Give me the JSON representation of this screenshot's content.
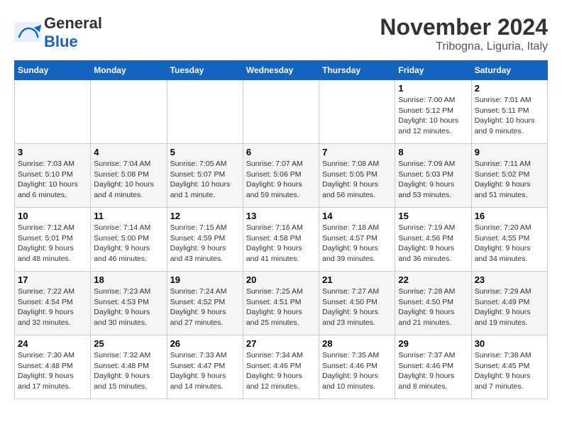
{
  "header": {
    "logo_text_general": "General",
    "logo_text_blue": "Blue",
    "month_title": "November 2024",
    "location": "Tribogna, Liguria, Italy"
  },
  "days_of_week": [
    "Sunday",
    "Monday",
    "Tuesday",
    "Wednesday",
    "Thursday",
    "Friday",
    "Saturday"
  ],
  "weeks": [
    [
      {
        "day": "",
        "info": ""
      },
      {
        "day": "",
        "info": ""
      },
      {
        "day": "",
        "info": ""
      },
      {
        "day": "",
        "info": ""
      },
      {
        "day": "",
        "info": ""
      },
      {
        "day": "1",
        "info": "Sunrise: 7:00 AM\nSunset: 5:12 PM\nDaylight: 10 hours and 12 minutes."
      },
      {
        "day": "2",
        "info": "Sunrise: 7:01 AM\nSunset: 5:11 PM\nDaylight: 10 hours and 9 minutes."
      }
    ],
    [
      {
        "day": "3",
        "info": "Sunrise: 7:03 AM\nSunset: 5:10 PM\nDaylight: 10 hours and 6 minutes."
      },
      {
        "day": "4",
        "info": "Sunrise: 7:04 AM\nSunset: 5:08 PM\nDaylight: 10 hours and 4 minutes."
      },
      {
        "day": "5",
        "info": "Sunrise: 7:05 AM\nSunset: 5:07 PM\nDaylight: 10 hours and 1 minute."
      },
      {
        "day": "6",
        "info": "Sunrise: 7:07 AM\nSunset: 5:06 PM\nDaylight: 9 hours and 59 minutes."
      },
      {
        "day": "7",
        "info": "Sunrise: 7:08 AM\nSunset: 5:05 PM\nDaylight: 9 hours and 56 minutes."
      },
      {
        "day": "8",
        "info": "Sunrise: 7:09 AM\nSunset: 5:03 PM\nDaylight: 9 hours and 53 minutes."
      },
      {
        "day": "9",
        "info": "Sunrise: 7:11 AM\nSunset: 5:02 PM\nDaylight: 9 hours and 51 minutes."
      }
    ],
    [
      {
        "day": "10",
        "info": "Sunrise: 7:12 AM\nSunset: 5:01 PM\nDaylight: 9 hours and 48 minutes."
      },
      {
        "day": "11",
        "info": "Sunrise: 7:14 AM\nSunset: 5:00 PM\nDaylight: 9 hours and 46 minutes."
      },
      {
        "day": "12",
        "info": "Sunrise: 7:15 AM\nSunset: 4:59 PM\nDaylight: 9 hours and 43 minutes."
      },
      {
        "day": "13",
        "info": "Sunrise: 7:16 AM\nSunset: 4:58 PM\nDaylight: 9 hours and 41 minutes."
      },
      {
        "day": "14",
        "info": "Sunrise: 7:18 AM\nSunset: 4:57 PM\nDaylight: 9 hours and 39 minutes."
      },
      {
        "day": "15",
        "info": "Sunrise: 7:19 AM\nSunset: 4:56 PM\nDaylight: 9 hours and 36 minutes."
      },
      {
        "day": "16",
        "info": "Sunrise: 7:20 AM\nSunset: 4:55 PM\nDaylight: 9 hours and 34 minutes."
      }
    ],
    [
      {
        "day": "17",
        "info": "Sunrise: 7:22 AM\nSunset: 4:54 PM\nDaylight: 9 hours and 32 minutes."
      },
      {
        "day": "18",
        "info": "Sunrise: 7:23 AM\nSunset: 4:53 PM\nDaylight: 9 hours and 30 minutes."
      },
      {
        "day": "19",
        "info": "Sunrise: 7:24 AM\nSunset: 4:52 PM\nDaylight: 9 hours and 27 minutes."
      },
      {
        "day": "20",
        "info": "Sunrise: 7:25 AM\nSunset: 4:51 PM\nDaylight: 9 hours and 25 minutes."
      },
      {
        "day": "21",
        "info": "Sunrise: 7:27 AM\nSunset: 4:50 PM\nDaylight: 9 hours and 23 minutes."
      },
      {
        "day": "22",
        "info": "Sunrise: 7:28 AM\nSunset: 4:50 PM\nDaylight: 9 hours and 21 minutes."
      },
      {
        "day": "23",
        "info": "Sunrise: 7:29 AM\nSunset: 4:49 PM\nDaylight: 9 hours and 19 minutes."
      }
    ],
    [
      {
        "day": "24",
        "info": "Sunrise: 7:30 AM\nSunset: 4:48 PM\nDaylight: 9 hours and 17 minutes."
      },
      {
        "day": "25",
        "info": "Sunrise: 7:32 AM\nSunset: 4:48 PM\nDaylight: 9 hours and 15 minutes."
      },
      {
        "day": "26",
        "info": "Sunrise: 7:33 AM\nSunset: 4:47 PM\nDaylight: 9 hours and 14 minutes."
      },
      {
        "day": "27",
        "info": "Sunrise: 7:34 AM\nSunset: 4:46 PM\nDaylight: 9 hours and 12 minutes."
      },
      {
        "day": "28",
        "info": "Sunrise: 7:35 AM\nSunset: 4:46 PM\nDaylight: 9 hours and 10 minutes."
      },
      {
        "day": "29",
        "info": "Sunrise: 7:37 AM\nSunset: 4:46 PM\nDaylight: 9 hours and 8 minutes."
      },
      {
        "day": "30",
        "info": "Sunrise: 7:38 AM\nSunset: 4:45 PM\nDaylight: 9 hours and 7 minutes."
      }
    ]
  ]
}
